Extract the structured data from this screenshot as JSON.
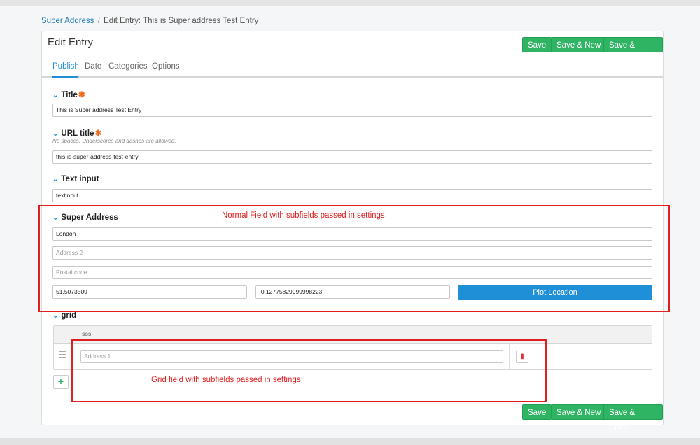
{
  "breadcrumb": {
    "parent": "Super Address",
    "separator": "/",
    "current": "Edit Entry: This is Super address Test Entry"
  },
  "card": {
    "title": "Edit Entry"
  },
  "actions": {
    "save": "Save",
    "save_new": "Save & New",
    "save_close": "Save & Close"
  },
  "tabs": [
    "Publish",
    "Date",
    "Categories",
    "Options"
  ],
  "fields": {
    "title": {
      "label": "Title",
      "required": "✱",
      "value": "This is Super address Test Entry"
    },
    "url_title": {
      "label": "URL title",
      "required": "✱",
      "hint": "No spaces. Underscores and dashes are allowed.",
      "value": "this-is-super-address-test-entry"
    },
    "text_input": {
      "label": "Text input",
      "value": "textinput"
    },
    "super_address": {
      "label": "Super Address",
      "address1_value": "London",
      "address2_placeholder": "Address 2",
      "postal_placeholder": "Postal code",
      "latitude": "51.5073509",
      "longitude": "-0.12775829999998223",
      "plot_label": "Plot Location"
    },
    "grid": {
      "label": "grid",
      "column": "sss",
      "address1_placeholder": "Address 1",
      "add_symbol": "+"
    }
  },
  "annotations": {
    "normal": "Normal Field with subfields passed in settings",
    "grid": "Grid field with subfields passed in settings"
  },
  "icons": {
    "chevron": "chevron-down-icon",
    "trash": "trash-icon",
    "drag": "drag-handle-icon",
    "add": "plus-icon"
  },
  "colors": {
    "accent": "#1f8fd8",
    "save": "#2fb463",
    "annotation": "#e02020",
    "required": "#f06a1e"
  }
}
